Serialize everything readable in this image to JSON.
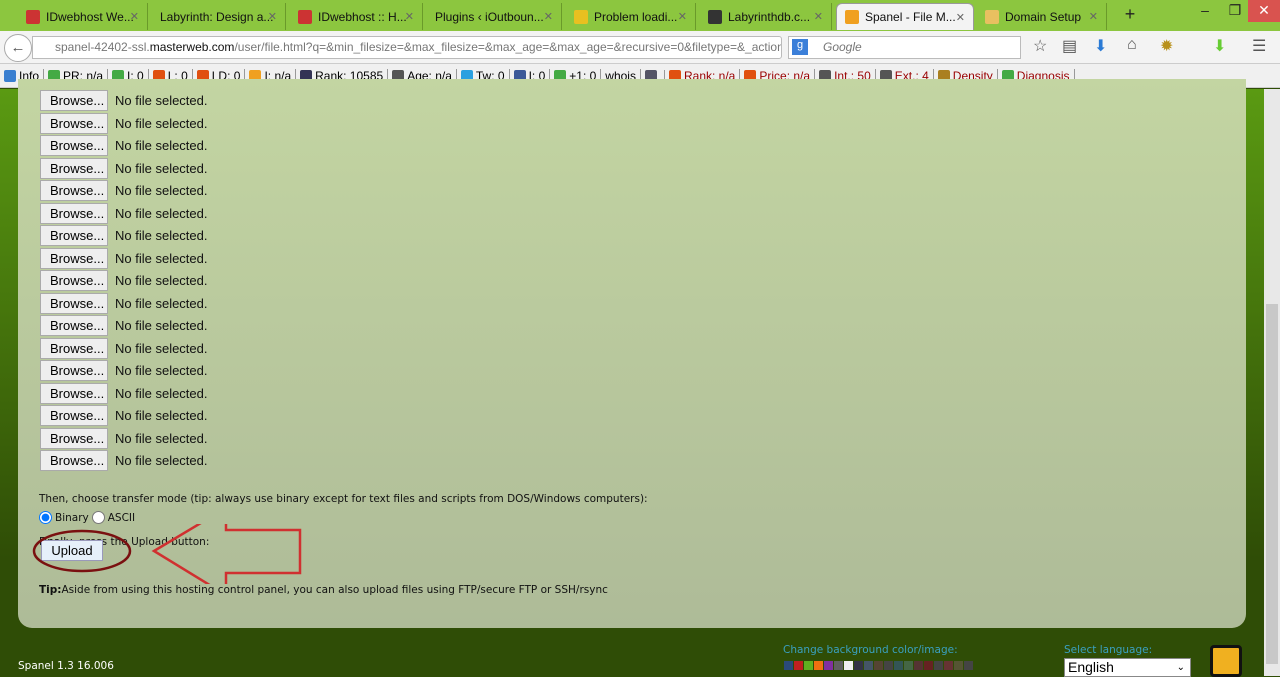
{
  "browser": {
    "tabs": [
      {
        "label": "IDwebhost We...",
        "icon": "idwebhost-icon"
      },
      {
        "label": "Labyrinth: Design a...",
        "icon": "none"
      },
      {
        "label": "IDwebhost :: H...",
        "icon": "idwebhost-icon"
      },
      {
        "label": "Plugins ‹ iOutboun...",
        "icon": "none"
      },
      {
        "label": "Problem loadi...",
        "icon": "warning-icon"
      },
      {
        "label": "Labyrinthdb.c...",
        "icon": "wordpress-icon"
      },
      {
        "label": "Spanel - File M...",
        "icon": "spanel-icon",
        "active": true
      },
      {
        "label": "Domain Setup",
        "icon": "mail-icon"
      }
    ],
    "url_prefix": "spanel-42402-ssl.",
    "url_domain": "masterweb.com",
    "url_path": "/user/file.html?q=&min_filesize=&max_filesize=&max_age=&max_age=&recursive=0&filetype=&_action",
    "search_placeholder": "Google",
    "bookmarks": [
      "Info",
      "PR: n/a",
      "I: 0",
      "L: 0",
      "LD: 0",
      "I: n/a",
      "Rank: 10585",
      "Age: n/a",
      "Tw: 0",
      "I: 0",
      "+1: 0",
      "whois",
      "",
      "Rank: n/a",
      "Price: n/a",
      "Int.: 50",
      "Ext.: 4",
      "Density",
      "Diagnosis"
    ]
  },
  "upload": {
    "browse_label": "Browse...",
    "no_file": "No file selected.",
    "rows": 17,
    "mode_prompt": "Then, choose transfer mode (tip: always use binary except for text files and scripts from DOS/Windows computers):",
    "mode_binary": "Binary",
    "mode_ascii": "ASCII",
    "mode_selected": "Binary",
    "press_prompt": "Finally, press the Upload button:",
    "upload_label": "Upload",
    "tip_bold": "Tip:",
    "tip": "Aside from using this hosting control panel, you can also upload files using FTP/secure FTP or SSH/rsync"
  },
  "footer": {
    "version": "Spanel 1.3 16.006",
    "bg_label": "Change background color/image:",
    "lang_label": "Select language:",
    "language": "English",
    "swatches": [
      "#2a4a7a",
      "#c02020",
      "#60b020",
      "#f07010",
      "#8030a0",
      "#606060",
      "#f0f0f0",
      "#334",
      "#456",
      "#543",
      "#444",
      "#355",
      "#464",
      "#533",
      "#622",
      "#444",
      "#633",
      "#553",
      "#444"
    ]
  }
}
